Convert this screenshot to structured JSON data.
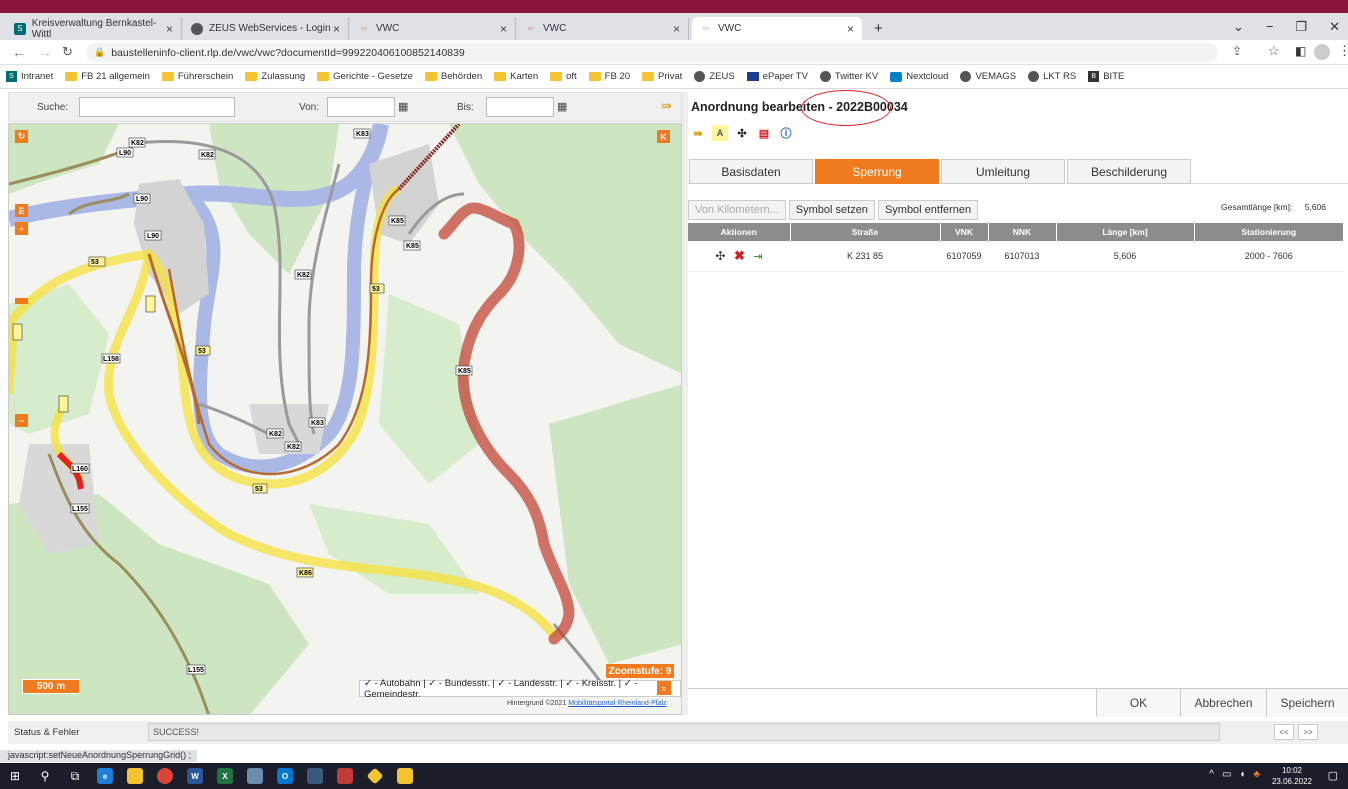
{
  "browser": {
    "tabs": [
      {
        "title": "Kreisverwaltung Bernkastel-Wittl",
        "icon": "sharepoint-icon",
        "active": false
      },
      {
        "title": "ZEUS WebServices - Login",
        "icon": "globe-icon",
        "active": false
      },
      {
        "title": "VWC",
        "icon": "vwc-icon",
        "active": false
      },
      {
        "title": "VWC",
        "icon": "vwc-icon",
        "active": false
      },
      {
        "title": "VWC",
        "icon": "vwc-icon",
        "active": true
      }
    ],
    "new_tab": "+",
    "url": "baustelleninfo-client.rlp.de/vwc/vwc?documentId=99922040610085214083​9",
    "bookmarks": [
      "Intranet",
      "FB 21 allgemein",
      "Führerschein",
      "Zulassung",
      "Gerichte - Gesetze",
      "Behörden",
      "Karten",
      "oft",
      "FB 20",
      "Privat",
      "ZEUS",
      "ePaper TV",
      "Twitter KV",
      "Nextcloud",
      "VEMAGS",
      "LKT RS",
      "BITE"
    ]
  },
  "search_bar": {
    "search_label": "Suche:",
    "from_label": "Von:",
    "to_label": "Bis:"
  },
  "map": {
    "scale": "500 m",
    "zoom": "Zoomstufe: 9",
    "legend": "✓ - Autobahn | ✓ - Bundesstr. | ✓ - Landesstr. | ✓ - Kreisstr. | ✓ - Gemeindestr.",
    "legend_arrow": "»",
    "attribution_prefix": "Hintergrund ©2021",
    "attribution_link": "Mobilitätsportal Rheinland-Pfalz",
    "buttons": {
      "refresh": "↻",
      "e": "E",
      "plus": "+",
      "minus": "−",
      "k": "K"
    },
    "road_labels": [
      "K82",
      "L90",
      "K82",
      "L90",
      "L90",
      "K83",
      "K85",
      "K85",
      "K82",
      "53",
      "53",
      "53",
      "L158",
      "K82",
      "K83",
      "K82",
      "K85",
      "L160",
      "K86",
      "L155",
      "L155",
      "53"
    ]
  },
  "panel": {
    "title_prefix": "Anordnung bearbeiten",
    "title_sep": " - ",
    "document_id": "2022B00034",
    "tabs": [
      "Basisdaten",
      "Sperrung",
      "Umleitung",
      "Beschilderung"
    ],
    "active_tab": "Sperrung",
    "sub_buttons": {
      "from_km": "Von Kilometern...",
      "set_symbol": "Symbol setzen",
      "remove_symbol": "Symbol entfernen"
    },
    "total_length_label": "Gesamtlänge [km]:",
    "total_length_value": "5,606",
    "table": {
      "headers": [
        "Aktionen",
        "Straße",
        "VNK",
        "NNK",
        "Länge [km]",
        "Stationierung"
      ],
      "rows": [
        {
          "street": "K 231 85",
          "vnk": "6107059",
          "nnk": "6107013",
          "length": "5,606",
          "station": "2000 - 7606"
        }
      ]
    },
    "footer": {
      "ok": "OK",
      "cancel": "Abbrechen",
      "save": "Speichern"
    }
  },
  "status": {
    "label": "Status & Fehler",
    "message": "SUCCESS!",
    "prev": "<<",
    "next": ">>"
  },
  "js_status": "javascript:setNeueAnordnungSperrungGrid() ;",
  "taskbar": {
    "time": "10:02",
    "date": "23.06.2022"
  },
  "colors": {
    "brand_strip": "#8a1538",
    "accent": "#f07a1e",
    "closure_route": "#c0392b",
    "detour_route": "#f5e23a",
    "river": "#aab8e6"
  }
}
